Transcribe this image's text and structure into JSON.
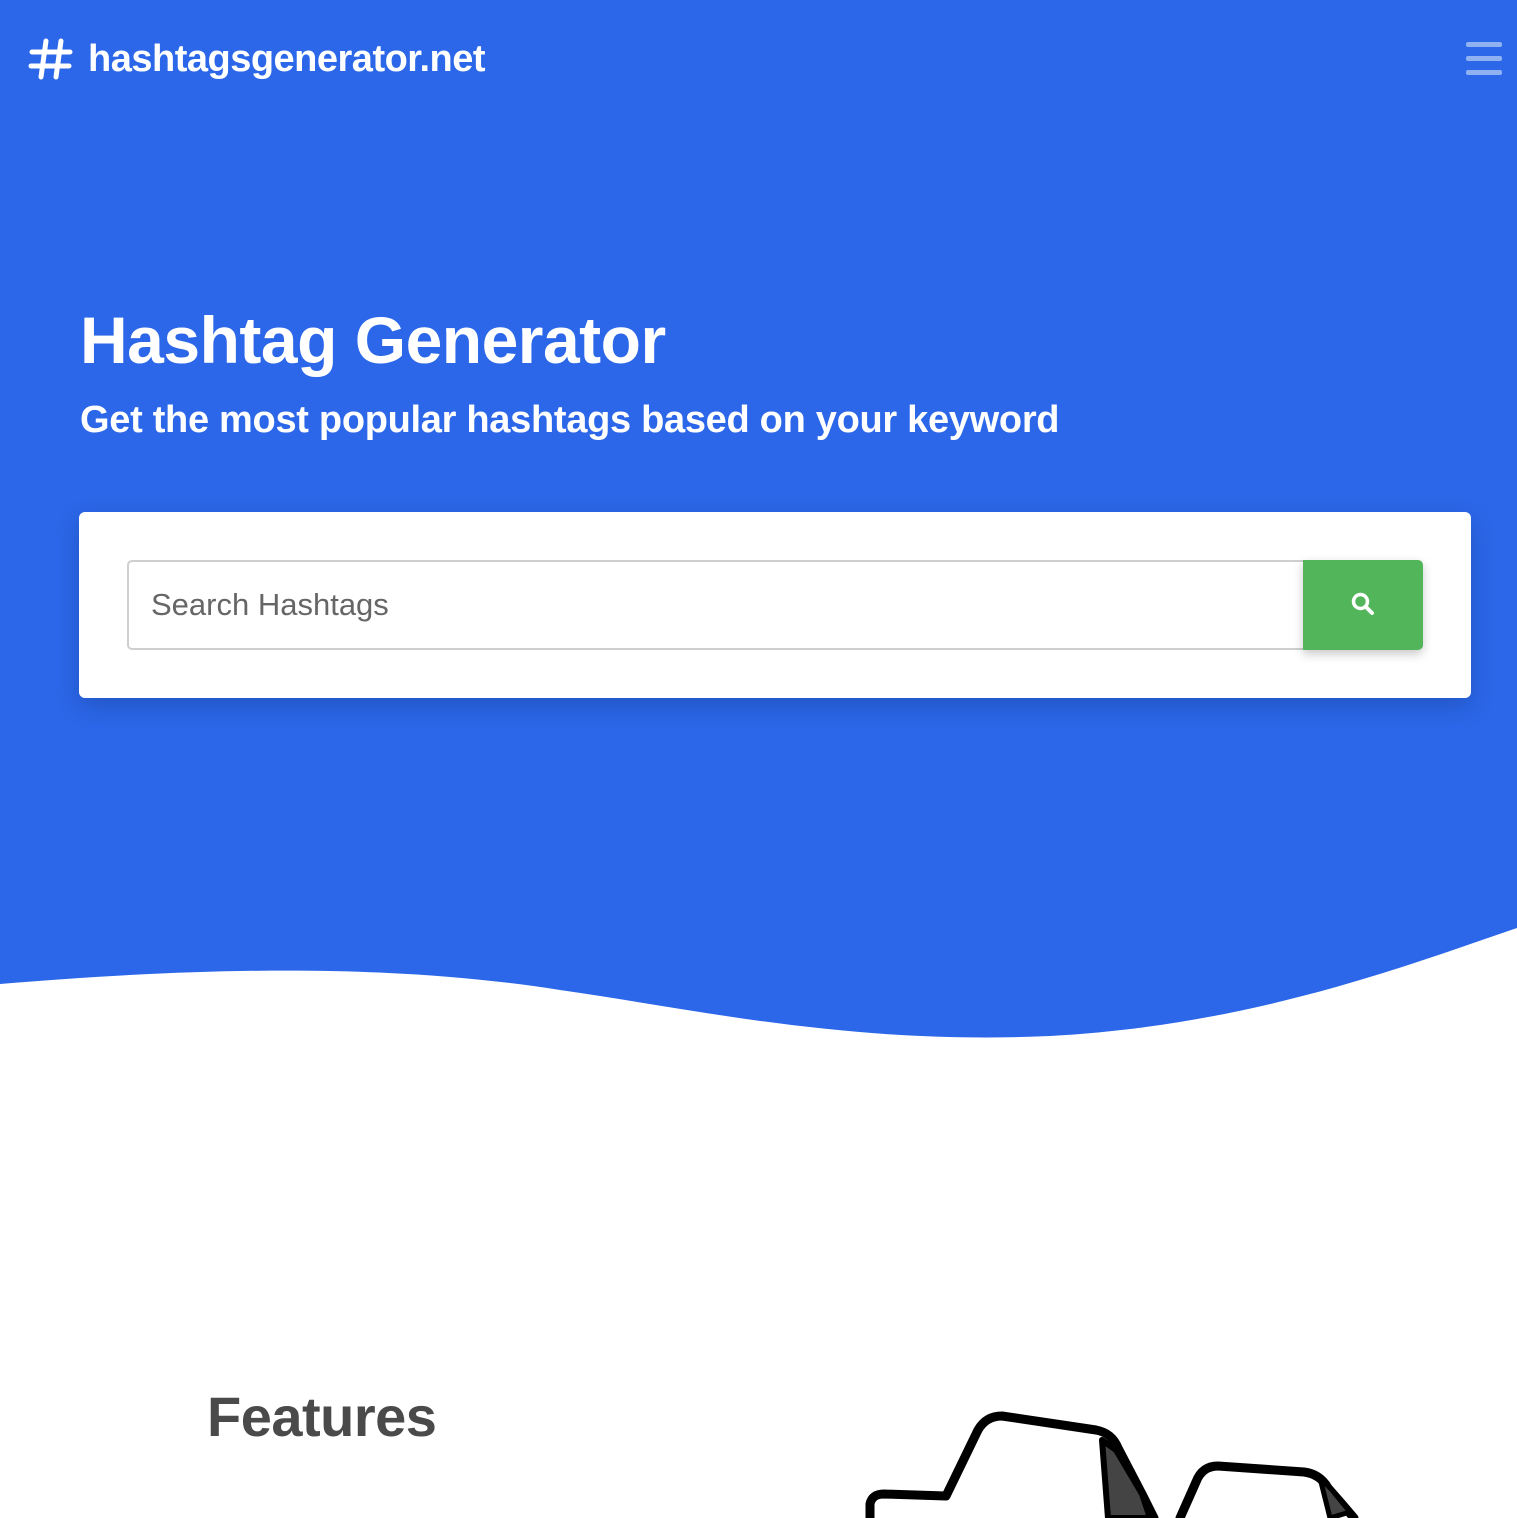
{
  "brand": {
    "icon": "hashtag-icon",
    "name": "hashtagsgenerator.net"
  },
  "nav": {
    "menu_icon": "hamburger-menu-icon"
  },
  "hero": {
    "title": "Hashtag Generator",
    "subtitle": "Get the most popular hashtags based on your keyword"
  },
  "search": {
    "placeholder": "Search Hashtags",
    "value": "",
    "button_icon": "search-icon"
  },
  "features": {
    "title": "Features"
  },
  "colors": {
    "hero_background": "#2b67e8",
    "search_button": "#52b55a",
    "heading_dark": "#4a4a4a",
    "menu_icon": "#8fb1f2"
  }
}
